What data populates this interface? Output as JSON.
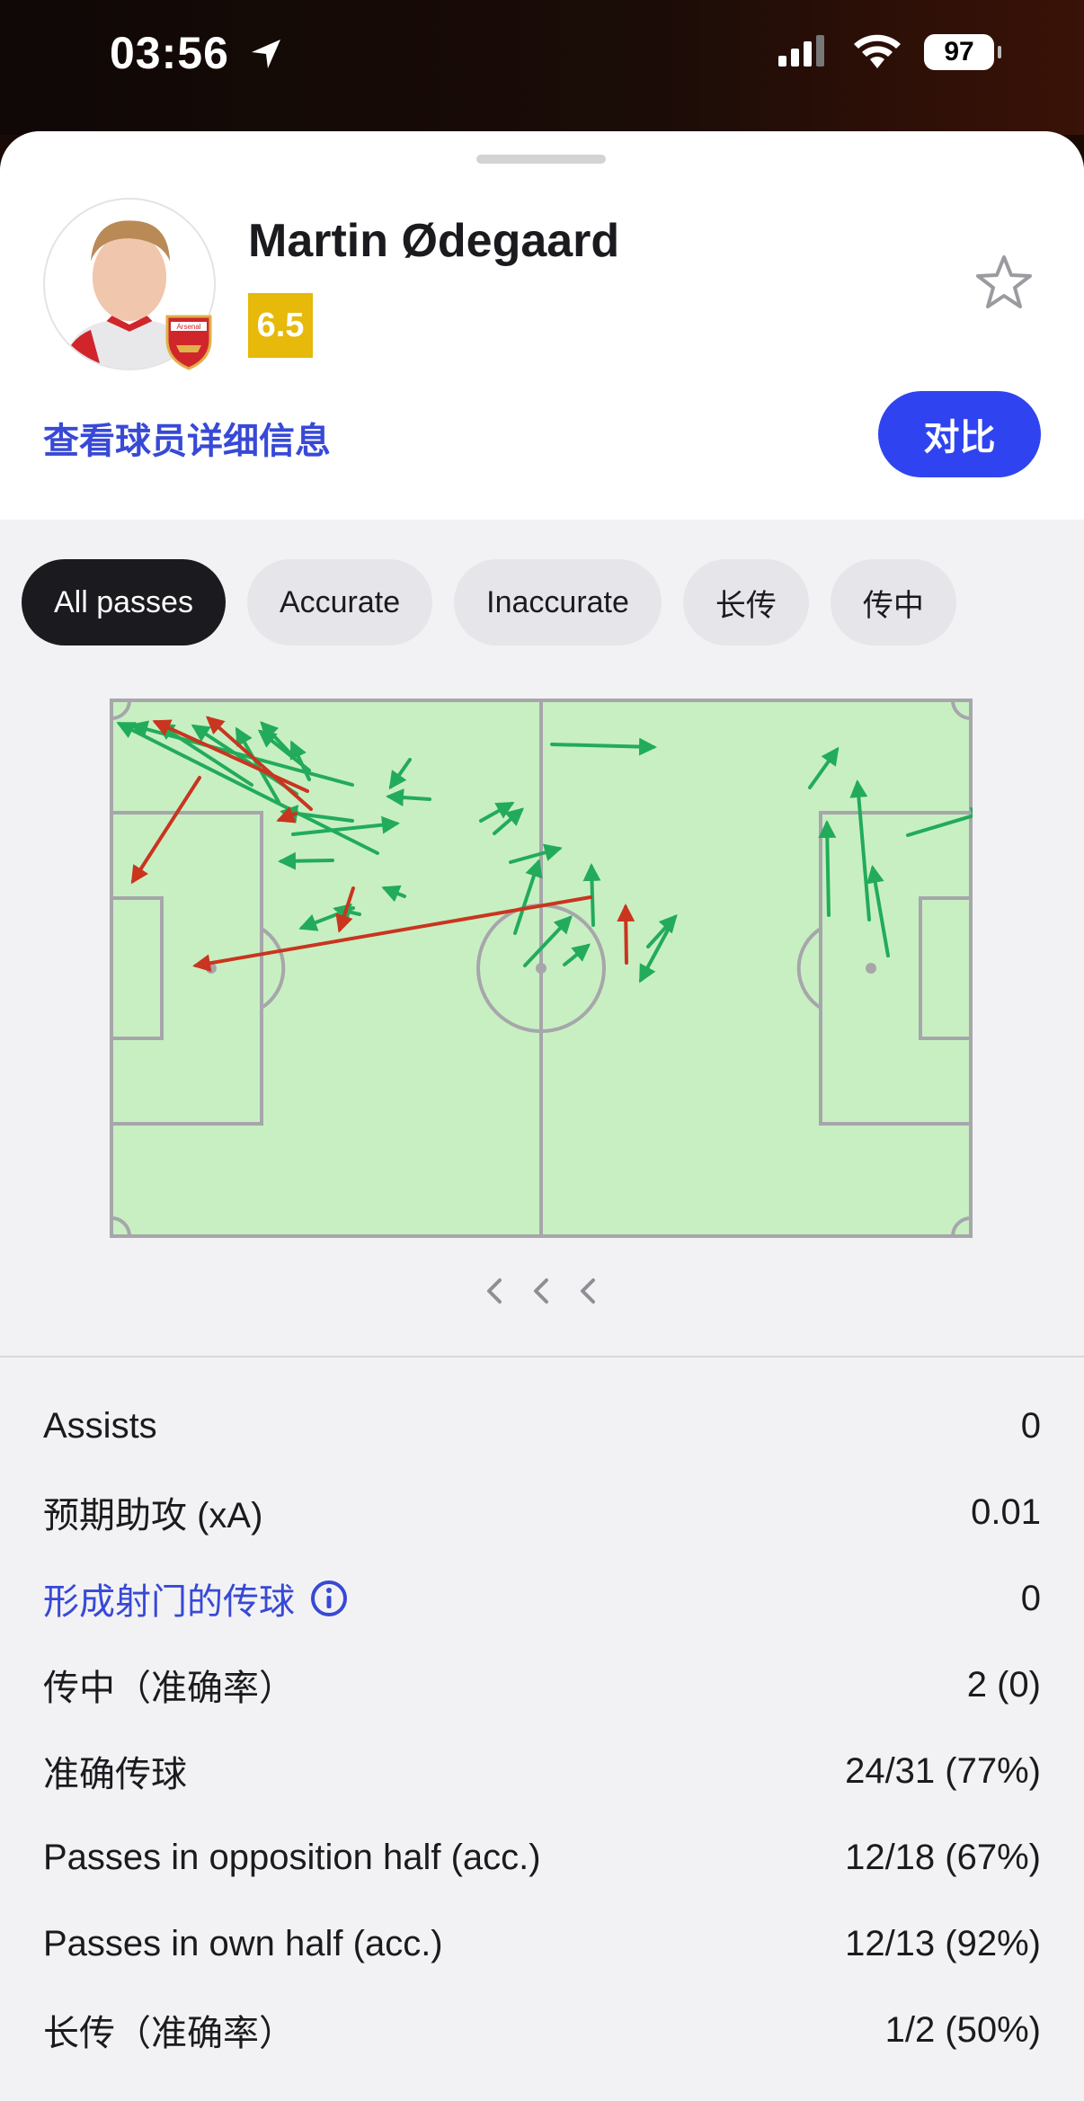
{
  "status": {
    "time": "03:56",
    "battery": "97"
  },
  "player": {
    "name": "Martin Ødegaard",
    "rating": "6.5",
    "club_badge_text": "Arsenal"
  },
  "actions": {
    "details_link": "查看球员详细信息",
    "compare": "对比"
  },
  "filters": [
    "All passes",
    "Accurate",
    "Inaccurate",
    "长传",
    "传中"
  ],
  "active_filter": 0,
  "colors": {
    "accent": "#2f44f0",
    "link": "#3849d6",
    "rating": "#e6b90a",
    "pass_success": "#22ab5b",
    "pass_fail": "#c9351f",
    "pitch": "#c8efc2"
  },
  "pass_map": {
    "accurate_passes": [
      [
        [
          392,
          96
        ],
        [
          148,
          30
        ]
      ],
      [
        [
          280,
          96
        ],
        [
          177,
          29
        ]
      ],
      [
        [
          420,
          172
        ],
        [
          133,
          28
        ]
      ],
      [
        [
          330,
          106
        ],
        [
          216,
          31
        ]
      ],
      [
        [
          310,
          115
        ],
        [
          264,
          35
        ]
      ],
      [
        [
          344,
          80
        ],
        [
          290,
          37
        ]
      ],
      [
        [
          392,
          136
        ],
        [
          315,
          126
        ]
      ],
      [
        [
          478,
          112
        ],
        [
          433,
          109
        ]
      ],
      [
        [
          400,
          240
        ],
        [
          374,
          234
        ]
      ],
      [
        [
          322,
          60
        ],
        [
          292,
          28
        ]
      ],
      [
        [
          344,
          90
        ],
        [
          325,
          50
        ]
      ],
      [
        [
          456,
          68
        ],
        [
          435,
          98
        ]
      ],
      [
        [
          450,
          220
        ],
        [
          428,
          211
        ]
      ],
      [
        [
          326,
          151
        ],
        [
          441,
          139
        ]
      ],
      [
        [
          393,
          233
        ],
        [
          336,
          255
        ]
      ],
      [
        [
          370,
          180
        ],
        [
          313,
          181
        ]
      ],
      [
        [
          535,
          136
        ],
        [
          569,
          117
        ]
      ],
      [
        [
          550,
          150
        ],
        [
          580,
          124
        ]
      ],
      [
        [
          568,
          182
        ],
        [
          622,
          167
        ]
      ],
      [
        [
          573,
          261
        ],
        [
          599,
          182
        ]
      ],
      [
        [
          584,
          297
        ],
        [
          634,
          244
        ]
      ],
      [
        [
          660,
          252
        ],
        [
          658,
          187
        ]
      ],
      [
        [
          628,
          296
        ],
        [
          654,
          275
        ]
      ],
      [
        [
          721,
          276
        ],
        [
          751,
          243
        ]
      ],
      [
        [
          746,
          252
        ],
        [
          713,
          313
        ]
      ],
      [
        [
          901,
          99
        ],
        [
          931,
          57
        ]
      ],
      [
        [
          922,
          241
        ],
        [
          920,
          139
        ]
      ],
      [
        [
          967,
          246
        ],
        [
          954,
          94
        ]
      ],
      [
        [
          1010,
          152
        ],
        [
          1097,
          126
        ]
      ],
      [
        [
          614,
          51
        ],
        [
          727,
          54
        ]
      ],
      [
        [
          988,
          286
        ],
        [
          971,
          189
        ]
      ],
      [
        [
          1162,
          284
        ],
        [
          1149,
          88
        ]
      ]
    ],
    "inaccurate_passes": [
      [
        [
          342,
          103
        ],
        [
          173,
          26
        ]
      ],
      [
        [
          346,
          123
        ],
        [
          232,
          22
        ]
      ],
      [
        [
          222,
          88
        ],
        [
          148,
          203
        ]
      ],
      [
        [
          329,
          128
        ],
        [
          311,
          135
        ]
      ],
      [
        [
          393,
          211
        ],
        [
          378,
          257
        ]
      ],
      [
        [
          657,
          221
        ],
        [
          218,
          297
        ]
      ],
      [
        [
          697,
          294
        ],
        [
          696,
          232
        ]
      ]
    ]
  },
  "stats": [
    {
      "label": "Assists",
      "value": "0"
    },
    {
      "label": "预期助攻 (xA)",
      "value": "0.01"
    },
    {
      "label": "形成射门的传球",
      "value": "0",
      "info": true
    },
    {
      "label": "传中（准确率）",
      "value": "2 (0)"
    },
    {
      "label": "准确传球",
      "value": "24/31 (77%)"
    },
    {
      "label": "Passes in opposition half (acc.)",
      "value": "12/18 (67%)"
    },
    {
      "label": "Passes in own half (acc.)",
      "value": "12/13 (92%)"
    },
    {
      "label": "长传（准确率）",
      "value": "1/2 (50%)"
    }
  ]
}
